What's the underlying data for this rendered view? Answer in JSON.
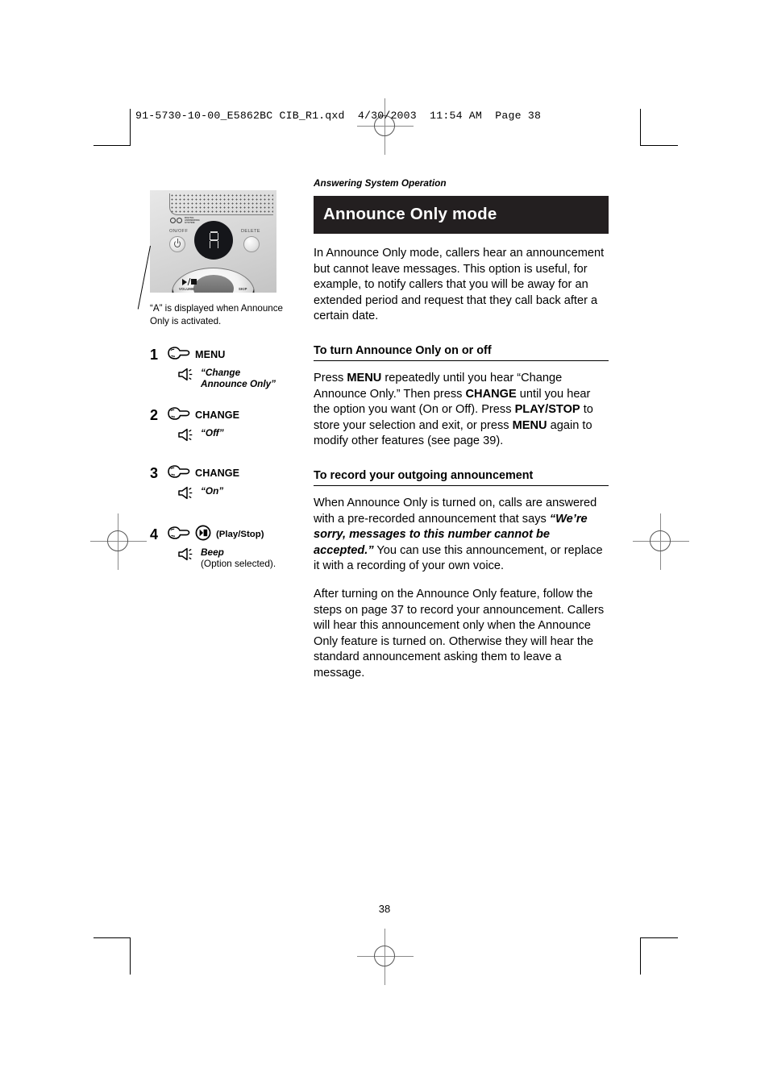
{
  "prepress": {
    "header": "91-5730-10-00_E5862BC CIB_R1.qxd  4/30/2003  11:54 AM  Page 38"
  },
  "figure": {
    "device": {
      "logo_text": "DIGITAL ANSWERING SYSTEM",
      "label_onoff": "ON/OFF",
      "label_delete": "DELETE",
      "display_char": "A",
      "wheel_label_left": "VOLUME",
      "wheel_label_right": "SKIP"
    },
    "caption": "“A” is displayed when Announce Only is activated."
  },
  "steps": [
    {
      "number": "1",
      "key": "MENU",
      "sub_line1": "“Change",
      "sub_line2": "Announce Only”"
    },
    {
      "number": "2",
      "key": "CHANGE",
      "sub_line1": "“Off”",
      "sub_line2": ""
    },
    {
      "number": "3",
      "key": "CHANGE",
      "sub_line1": "“On”",
      "sub_line2": ""
    },
    {
      "number": "4",
      "key": "",
      "button_label": "(Play/Stop)",
      "sub_line1": "Beep",
      "sub_line2": "(Option selected)."
    }
  ],
  "content": {
    "kicker": "Answering System Operation",
    "title": "Announce Only mode",
    "intro": "In Announce Only mode, callers hear an announcement but cannot leave messages. This option is useful, for example, to notify callers that you will be away for an extended period and request that they call back after a certain date.",
    "section1": {
      "heading": "To turn Announce Only on or off",
      "p1_a": "Press ",
      "p1_b_menu": "MENU",
      "p1_c": " repeatedly until you hear “Change Announce Only.” Then press ",
      "p1_d_change": "CHANGE",
      "p1_e": " until you hear the option you want (On or Off). Press ",
      "p1_f_playstop": "PLAY/STOP",
      "p1_g": " to store your selection and exit, or press ",
      "p1_h_menu": "MENU",
      "p1_i": " again to modify other features (see page 39)."
    },
    "section2": {
      "heading": "To record your outgoing announcement",
      "p1_a": "When Announce Only is turned on, calls are answered with a pre-recorded announcement  that says ",
      "p1_quote": "“We’re sorry, messages to this number cannot be accepted.”",
      "p1_b": " You can use this announcement, or replace it with a recording of your own voice.",
      "p2": "After turning on the Announce Only feature, follow the steps on page 37 to record your announcement. Callers will hear this announcement only when the Announce Only feature is turned on. Otherwise they will hear the standard announcement asking them to leave a message."
    }
  },
  "page_number": "38",
  "colors": {
    "title_bar_bg": "#231f20",
    "title_bar_text": "#ffffff",
    "device_panel": "#d8d8d8"
  }
}
